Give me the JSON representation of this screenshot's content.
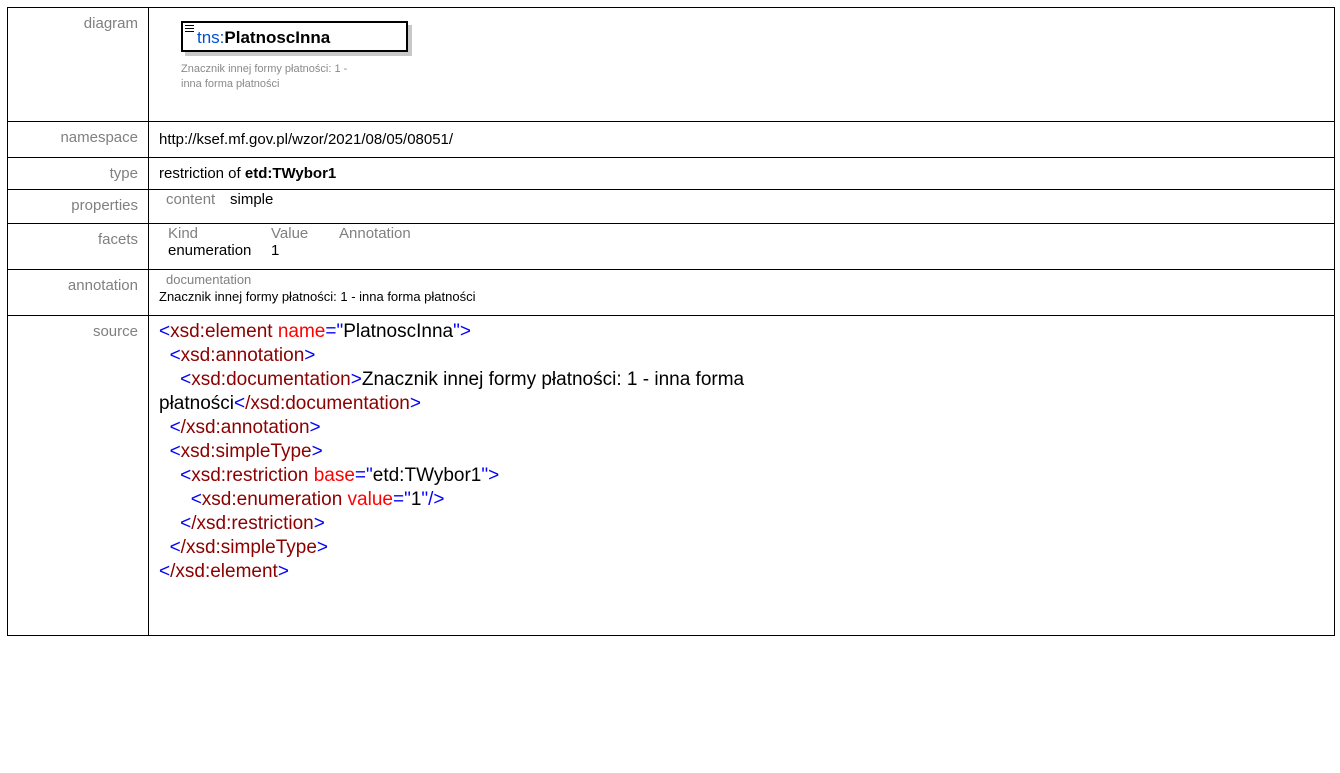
{
  "rows": {
    "diagram_label": "diagram",
    "namespace_label": "namespace",
    "type_label": "type",
    "properties_label": "properties",
    "facets_label": "facets",
    "annotation_label": "annotation",
    "source_label": "source"
  },
  "diagram": {
    "prefix": "tns:",
    "element_name": "PlatnoscInna",
    "doc_text": "Znacznik innej formy płatności: 1 - inna forma płatności"
  },
  "namespace": "http://ksef.mf.gov.pl/wzor/2021/08/05/08051/",
  "type": {
    "prefix_text": "restriction of ",
    "base": "etd:TWybor1"
  },
  "properties": {
    "key": "content",
    "value": "simple"
  },
  "facets": {
    "headers": [
      "Kind",
      "Value",
      "Annotation"
    ],
    "rows": [
      {
        "kind": "enumeration",
        "value": "1",
        "annotation": ""
      }
    ]
  },
  "annotation": {
    "key": "documentation",
    "text": "Znacznik innej formy płatności: 1 - inna forma płatności"
  },
  "source": {
    "line1_tag": "xsd:element",
    "line1_attr": "name",
    "line1_val": "PlatnoscInna",
    "line2_tag": "xsd:annotation",
    "line3_tag": "xsd:documentation",
    "line3_text": "Znacznik innej formy płatności: 1 - inna forma",
    "line4_text": "płatności",
    "line4_close": "/xsd:documentation",
    "line5_close": "/xsd:annotation",
    "line6_tag": "xsd:simpleType",
    "line7_tag": "xsd:restriction",
    "line7_attr": "base",
    "line7_val": "etd:TWybor1",
    "line8_tag": "xsd:enumeration",
    "line8_attr": "value",
    "line8_val": "1",
    "line9_close": "/xsd:restriction",
    "line10_close": "/xsd:simpleType",
    "line11_close": "/xsd:element"
  }
}
